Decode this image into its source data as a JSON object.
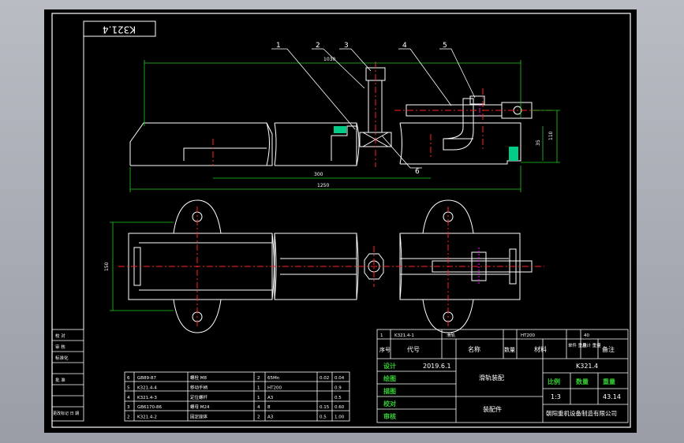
{
  "drawing": {
    "code_box": "K321.4",
    "balloons": [
      "1",
      "2",
      "3",
      "4",
      "5",
      "6"
    ],
    "dims": {
      "top": "1030",
      "inner": "300",
      "overall": "1250",
      "right_h1": "110",
      "right_h2": "35",
      "plan_w": "150"
    }
  },
  "rev_block": {
    "rows": [
      "校 对",
      "审 核",
      "标准化",
      "",
      "批 准",
      "",
      "",
      "更改标记 日 期"
    ]
  },
  "parts_list": {
    "header_row": {
      "no": "1",
      "code": "K321.4-1",
      "name": "滑轨",
      "material": "HT200",
      "weight": "40"
    },
    "headers": {
      "no": "序号",
      "code": "代号",
      "name": "名称",
      "qty": "数量",
      "material": "材料",
      "unit_weight": "单件 重量",
      "total_weight": "总计 重量",
      "remark": "备注"
    },
    "rows": [
      {
        "no": "6",
        "code": "GB89-87",
        "name": "螺栓 M8",
        "qty": "2",
        "material": "65Mn",
        "w1": "0.02",
        "w2": "0.04"
      },
      {
        "no": "5",
        "code": "K321.4-4",
        "name": "移动手柄",
        "qty": "1",
        "material": "HT200",
        "w1": "",
        "w2": "0.9"
      },
      {
        "no": "4",
        "code": "K321.4-3",
        "name": "定位螺杆",
        "qty": "1",
        "material": "A3",
        "w1": "",
        "w2": "0.5"
      },
      {
        "no": "3",
        "code": "GB6170-86",
        "name": "螺母 M24",
        "qty": "4",
        "material": "8",
        "w1": "0.15",
        "w2": "0.60"
      },
      {
        "no": "2",
        "code": "K321.4-2",
        "name": "固定座体",
        "qty": "2",
        "material": "A3",
        "w1": "0.5",
        "w2": "1.00"
      }
    ]
  },
  "title_block": {
    "rows": [
      {
        "label": "设计",
        "value": "2019.6.1"
      },
      {
        "label": "绘图",
        "value": ""
      },
      {
        "label": "描图",
        "value": ""
      },
      {
        "label": "校对",
        "value": ""
      },
      {
        "label": "审核",
        "value": ""
      }
    ],
    "title": "滑轨装配",
    "subtitle": "装配件",
    "drawing_no": "K321.4",
    "scale_label": "比例",
    "qty_label": "数量",
    "weight_label": "重量",
    "scale_value": "1:3",
    "qty_value": "",
    "weight_value": "43.14",
    "company": "朝阳重机设备制造有限公司"
  }
}
